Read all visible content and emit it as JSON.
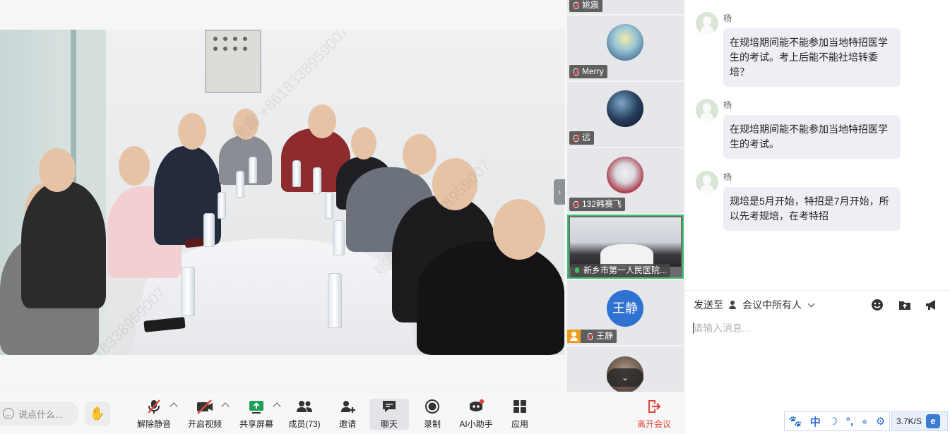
{
  "main_video": {
    "watermark_texts": [
      "姚震 +8618338959007"
    ]
  },
  "participants": {
    "tiles": [
      {
        "name": "姚震",
        "mic": "muted",
        "avatar": "cropped-avatar"
      },
      {
        "name": "Merry",
        "mic": "muted",
        "avatar": "anime-character-avatar"
      },
      {
        "name": "远",
        "mic": "muted",
        "avatar": "night-sky-avatar"
      },
      {
        "name": "132韩赛飞",
        "mic": "muted",
        "avatar": "anime-character-avatar"
      },
      {
        "name": "新乡市第一人民医院...",
        "mic": "active",
        "avatar": "meeting-room-video"
      },
      {
        "name": "王静",
        "mic": "muted",
        "avatar_text": "王静",
        "host": true
      }
    ],
    "scroll_down_icon": "chevron-down-icon"
  },
  "chat": {
    "messages": [
      {
        "sender": "杨",
        "text": "在规培期间能不能参加当地特招医学生的考试。考上后能不能社培转委培？"
      },
      {
        "sender": "杨",
        "text": "在规培期间能不能参加当地特招医学生的考试。"
      },
      {
        "sender": "杨",
        "text": "规培是5月开始，特招是7月开始，所以先考规培，在考特招"
      }
    ],
    "send_to_label": "发送至",
    "send_to_target": "会议中所有人",
    "input_placeholder": "请输入消息...",
    "tools": [
      "emoji-icon",
      "folder-upload-icon",
      "megaphone-icon"
    ]
  },
  "toolbar": {
    "say_placeholder": "说点什么...",
    "buttons": [
      {
        "label": "解除静音",
        "icon": "mic-muted-icon"
      },
      {
        "label": "开启视频",
        "icon": "video-off-icon"
      },
      {
        "label": "共享屏幕",
        "icon": "share-screen-icon"
      },
      {
        "label": "成员(73)",
        "icon": "members-icon"
      },
      {
        "label": "邀请",
        "icon": "invite-icon"
      },
      {
        "label": "聊天",
        "icon": "chat-icon"
      },
      {
        "label": "录制",
        "icon": "record-icon"
      },
      {
        "label": "AI小助手",
        "icon": "ai-assistant-icon"
      },
      {
        "label": "应用",
        "icon": "apps-icon"
      }
    ],
    "leave_label": "离开会议",
    "accent": "#e0483f"
  },
  "system_tray": {
    "ime_label": "中",
    "net_speed": "3.7K/S"
  }
}
